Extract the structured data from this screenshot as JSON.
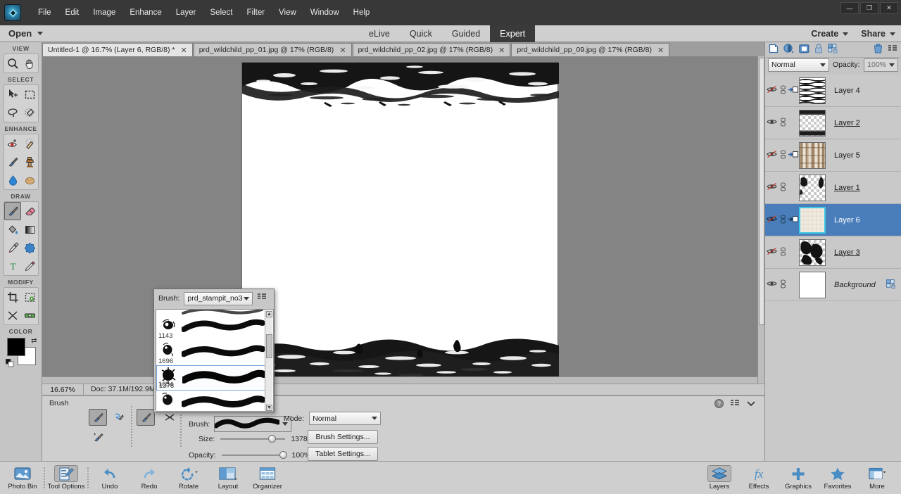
{
  "window": {
    "app_logo": "elements-logo-icon",
    "controls": {
      "minimize": "—",
      "maximize": "❐",
      "close": "✕"
    }
  },
  "menubar": {
    "items": [
      "File",
      "Edit",
      "Image",
      "Enhance",
      "Layer",
      "Select",
      "Filter",
      "View",
      "Window",
      "Help"
    ]
  },
  "openbar": {
    "open_label": "Open",
    "modes": [
      {
        "label": "eLive",
        "active": false
      },
      {
        "label": "Quick",
        "active": false
      },
      {
        "label": "Guided",
        "active": false
      },
      {
        "label": "Expert",
        "active": true
      }
    ],
    "create_label": "Create",
    "share_label": "Share"
  },
  "doctabs": [
    {
      "label": "Untitled-1 @ 16.7% (Layer 6, RGB/8) *",
      "active": true
    },
    {
      "label": "prd_wildchild_pp_01.jpg @ 17% (RGB/8)",
      "active": false
    },
    {
      "label": "prd_wildchild_pp_02.jpg @ 17% (RGB/8)",
      "active": false
    },
    {
      "label": "prd_wildchild_pp_09.jpg @ 17% (RGB/8)",
      "active": false
    }
  ],
  "toolbar": {
    "groups": [
      {
        "label": "VIEW",
        "tools": [
          "zoom-tool",
          "hand-tool"
        ]
      },
      {
        "label": "SELECT",
        "tools": [
          "move-tool",
          "rectangular-marquee-tool",
          "lasso-tool",
          "quick-selection-tool"
        ]
      },
      {
        "label": "ENHANCE",
        "tools": [
          "red-eye-removal-tool",
          "spot-healing-brush-tool",
          "smart-brush-tool",
          "clone-stamp-tool",
          "blur-tool",
          "sponge-tool"
        ]
      },
      {
        "label": "DRAW",
        "tools": [
          "brush-tool",
          "eraser-tool",
          "paint-bucket-tool",
          "gradient-tool",
          "eyedropper-tool",
          "custom-shape-tool",
          "type-tool",
          "pencil-tool"
        ]
      },
      {
        "label": "MODIFY",
        "tools": [
          "crop-tool",
          "recompose-tool",
          "content-aware-move-tool",
          "straighten-tool"
        ]
      }
    ],
    "color_label": "COLOR",
    "foreground_color": "#000000",
    "background_color": "#ffffff",
    "selected_tool": "brush-tool"
  },
  "statusbar": {
    "zoom": "16.67%",
    "doc_info": "Doc: 37.1M/192.9M"
  },
  "tool_options": {
    "title": "Brush",
    "brush_label": "Brush:",
    "size_label": "Size:",
    "size_value": "1378 px",
    "opacity_label": "Opacity:",
    "opacity_value": "100%",
    "mode_label": "Mode:",
    "mode_value": "Normal",
    "brush_settings_label": "Brush Settings...",
    "tablet_settings_label": "Tablet Settings...",
    "icons": [
      "brush-tool-icon",
      "impressionist-brush-icon",
      "color-replacement-brush-icon",
      "brush-preset-icon",
      "airbrush-icon"
    ],
    "panel_icons": [
      "help-icon",
      "panel-menu-icon",
      "collapse-chevron-icon"
    ]
  },
  "brush_popup": {
    "brush_label": "Brush:",
    "preset_name": "prd_stampit_no3",
    "menu_icon": "panel-menu-icon",
    "items": [
      {
        "size": "1143",
        "selected": false
      },
      {
        "size": "1696",
        "selected": false
      },
      {
        "size": "1654",
        "selected": false
      },
      {
        "size": "1378",
        "selected": true
      }
    ]
  },
  "layers_panel": {
    "toolbar_icons": [
      "new-layer-icon",
      "adjustment-layer-icon",
      "layer-mask-icon",
      "lock-icon",
      "group-lock-icon",
      "delete-layer-icon",
      "panel-menu-icon"
    ],
    "blend_mode": "Normal",
    "opacity_label": "Opacity:",
    "opacity_value": "100%",
    "layers": [
      {
        "name": "Layer 4",
        "visible": false,
        "clipped": true,
        "selected": false,
        "underline": true,
        "italic": false,
        "thumb": "hatched-texture",
        "locked": false
      },
      {
        "name": "Layer 2",
        "visible": true,
        "clipped": false,
        "selected": false,
        "underline": true,
        "italic": false,
        "thumb": "transparent-grunge",
        "locked": false
      },
      {
        "name": "Layer 5",
        "visible": false,
        "clipped": true,
        "selected": false,
        "underline": false,
        "italic": false,
        "thumb": "wood-texture",
        "locked": false
      },
      {
        "name": "Layer 1",
        "visible": false,
        "clipped": false,
        "selected": false,
        "underline": true,
        "italic": false,
        "thumb": "transparent-splat",
        "locked": false
      },
      {
        "name": "Layer 6",
        "visible": false,
        "clipped": true,
        "selected": true,
        "underline": false,
        "italic": false,
        "thumb": "paper-texture",
        "locked": false
      },
      {
        "name": "Layer 3",
        "visible": false,
        "clipped": false,
        "selected": false,
        "underline": true,
        "italic": false,
        "thumb": "transparent-ink",
        "locked": false
      },
      {
        "name": "Background",
        "visible": true,
        "clipped": false,
        "selected": false,
        "underline": false,
        "italic": true,
        "thumb": "white",
        "locked": true
      }
    ]
  },
  "taskbar": {
    "left_items": [
      {
        "label": "Photo Bin",
        "icon": "photo-bin-icon",
        "selected": false
      },
      {
        "label": "Tool Options",
        "icon": "tool-options-icon",
        "selected": true
      },
      {
        "label": "Undo",
        "icon": "undo-icon",
        "selected": false
      },
      {
        "label": "Redo",
        "icon": "redo-icon",
        "selected": false
      },
      {
        "label": "Rotate",
        "icon": "rotate-icon",
        "selected": false
      },
      {
        "label": "Layout",
        "icon": "layout-icon",
        "selected": false
      },
      {
        "label": "Organizer",
        "icon": "organizer-icon",
        "selected": false
      }
    ],
    "right_items": [
      {
        "label": "Layers",
        "icon": "layers-icon",
        "selected": true
      },
      {
        "label": "Effects",
        "icon": "effects-fx-icon",
        "selected": false
      },
      {
        "label": "Graphics",
        "icon": "graphics-plus-icon",
        "selected": false
      },
      {
        "label": "Favorites",
        "icon": "favorites-star-icon",
        "selected": false
      },
      {
        "label": "More",
        "icon": "more-panel-icon",
        "selected": false
      }
    ]
  },
  "canvas": {
    "document": "Untitled-1",
    "zoom": "16.67%",
    "content_description": "white canvas with black grunge brush strokes at top and bottom"
  },
  "colors": {
    "accent_blue": "#4a7ebb",
    "chrome_gray": "#cfcfcf",
    "dark_chrome": "#383838",
    "canvas_bg": "#848484"
  }
}
